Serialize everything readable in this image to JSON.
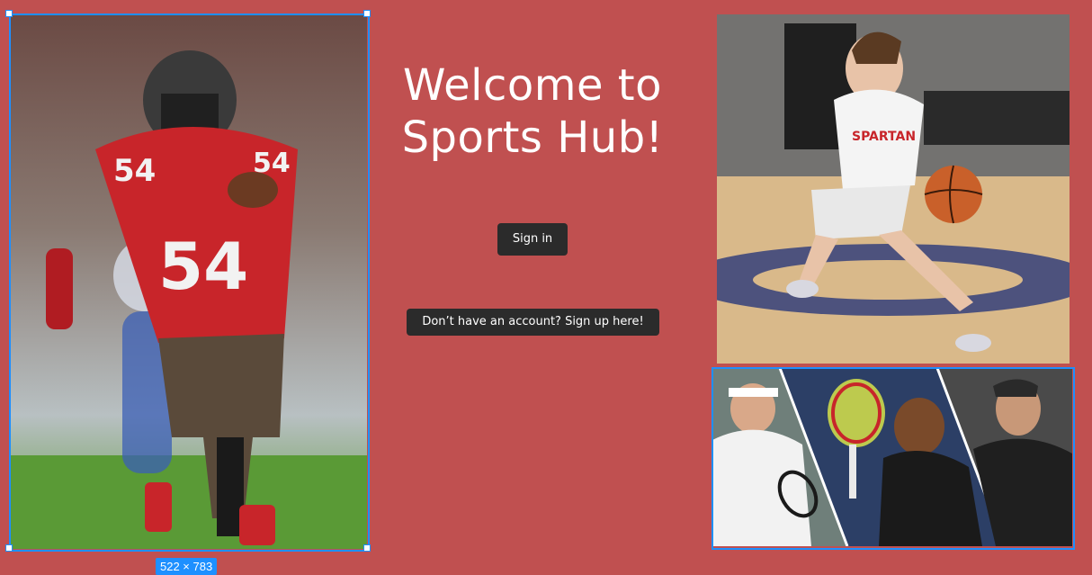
{
  "hero": {
    "title_line1": "Welcome to",
    "title_line2": "Sports Hub!"
  },
  "actions": {
    "sign_in_label": "Sign in",
    "sign_up_label": "Don’t have an account? Sign up here!"
  },
  "selection": {
    "size_label": "522 × 783"
  },
  "images": {
    "football": {
      "icon": "football-player-photo",
      "jersey_number": "54"
    },
    "basketball": {
      "icon": "basketball-player-photo",
      "jersey_text": "SPARTAN"
    },
    "tennis": {
      "icon": "tennis-players-collage"
    }
  },
  "colors": {
    "background": "#c05050",
    "button": "#2b2b2b",
    "selection": "#1e90ff"
  }
}
